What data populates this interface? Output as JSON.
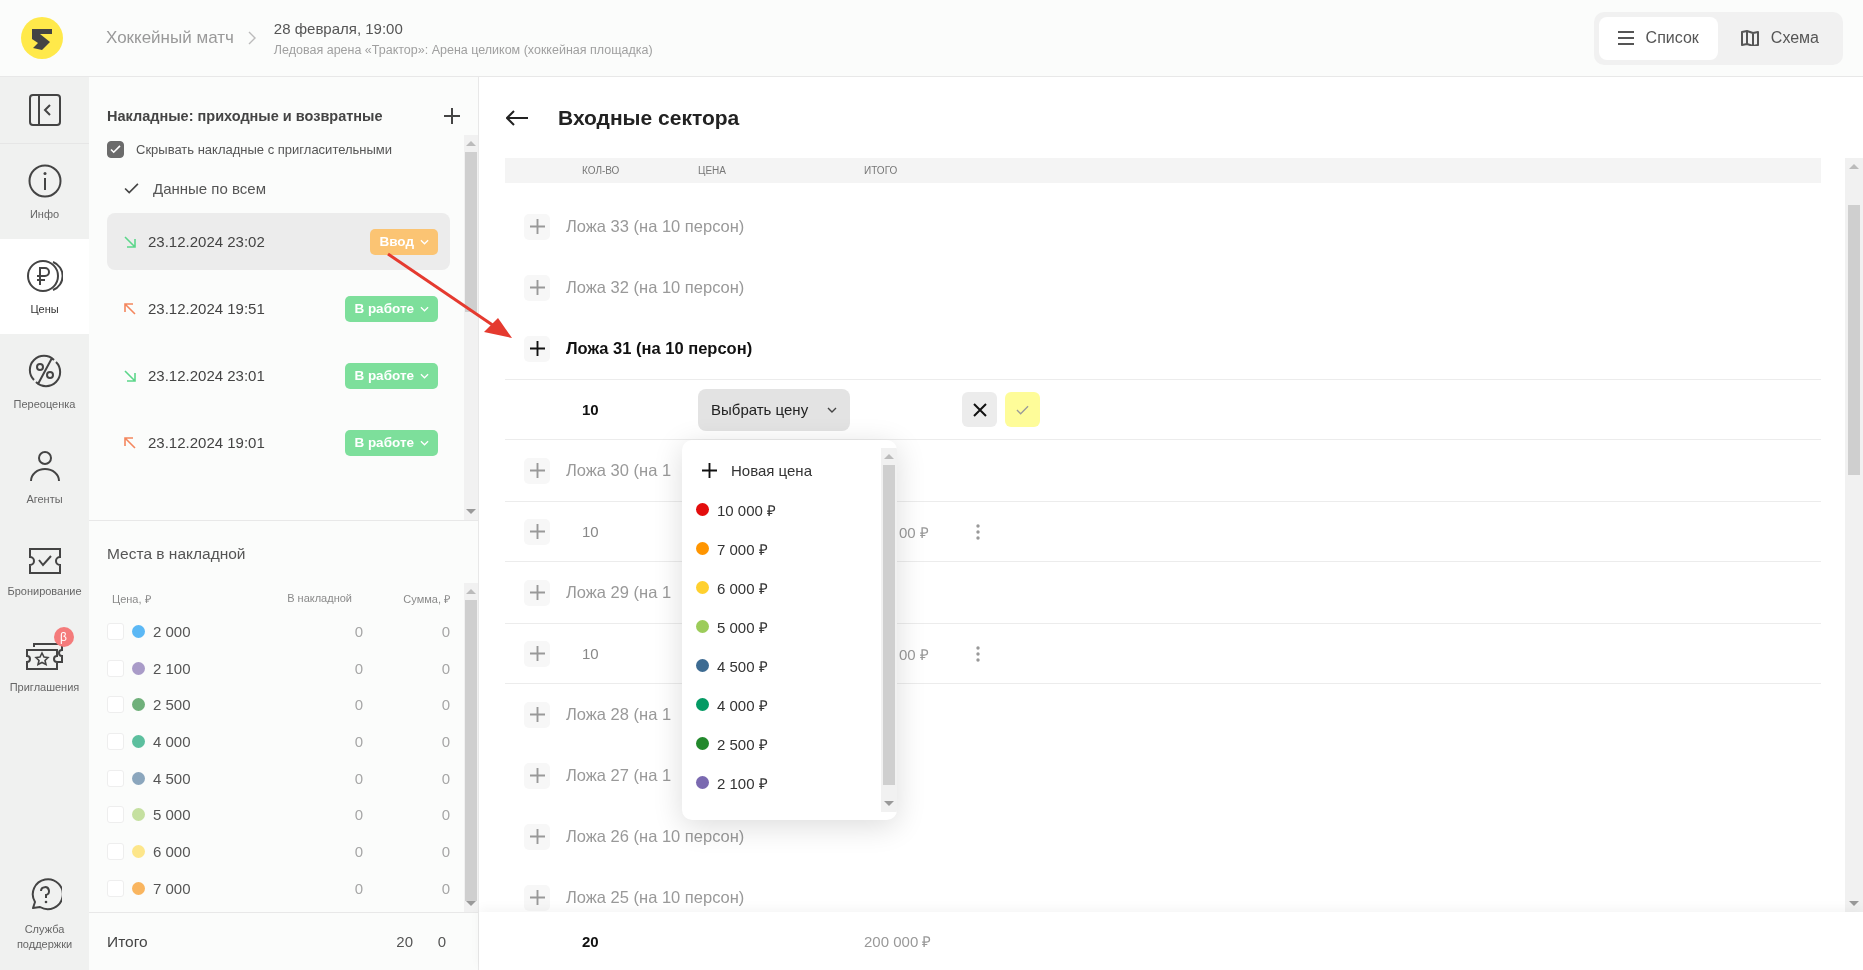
{
  "header": {
    "event": "Хоккейный матч",
    "date": "28 февраля, 19:00",
    "venue": "Ледовая арена «Трактор»: Арена целиком (хоккейная площадка)",
    "view_tabs": [
      {
        "label": "Список",
        "selected": true
      },
      {
        "label": "Схема",
        "selected": false
      }
    ]
  },
  "nav": [
    {
      "label": "Инфо",
      "selected": false
    },
    {
      "label": "Цены",
      "selected": true
    },
    {
      "label": "Переоценка",
      "selected": false
    },
    {
      "label": "Агенты",
      "selected": false
    },
    {
      "label": "Бронирование",
      "selected": false
    },
    {
      "label": "Приглашения",
      "selected": false,
      "badge": "β"
    }
  ],
  "support": {
    "label": "Служба поддержки"
  },
  "invoices": {
    "title": "Накладные: приходные и возвратные",
    "hide_invites": {
      "label": "Скрывать накладные с пригласительными",
      "checked": true
    },
    "all_data": {
      "label": "Данные по всем"
    },
    "items": [
      {
        "kind": "incoming",
        "date": "23.12.2024 23:02",
        "status": "Ввод",
        "color": "#fbc473",
        "selected": true
      },
      {
        "kind": "outgoing",
        "date": "23.12.2024 19:51",
        "status": "В работе",
        "color": "#7ddf9b",
        "selected": false
      },
      {
        "kind": "incoming",
        "date": "23.12.2024 23:01",
        "status": "В работе",
        "color": "#7ddf9b",
        "selected": false
      },
      {
        "kind": "outgoing",
        "date": "23.12.2024 19:01",
        "status": "В работе",
        "color": "#7ddf9b",
        "selected": false
      }
    ]
  },
  "places": {
    "title": "Места в накладной",
    "columns": [
      "Цена, ₽",
      "В накладной",
      "Сумма, ₽"
    ],
    "rows": [
      {
        "price": "2 000",
        "color": "#5bb8f5",
        "count": "0",
        "sum": "0",
        "checked": false
      },
      {
        "price": "2 100",
        "color": "#a99bc8",
        "count": "0",
        "sum": "0",
        "checked": false
      },
      {
        "price": "2 500",
        "color": "#6fb07a",
        "count": "0",
        "sum": "0",
        "checked": false
      },
      {
        "price": "4 000",
        "color": "#5cbf9e",
        "count": "0",
        "sum": "0",
        "checked": false
      },
      {
        "price": "4 500",
        "color": "#8ba6bd",
        "count": "0",
        "sum": "0",
        "checked": false
      },
      {
        "price": "5 000",
        "color": "#c5e0a0",
        "count": "0",
        "sum": "0",
        "checked": false
      },
      {
        "price": "6 000",
        "color": "#fde68a",
        "count": "0",
        "sum": "0",
        "checked": false
      },
      {
        "price": "7 000",
        "color": "#f9b55f",
        "count": "0",
        "sum": "0",
        "checked": false
      }
    ],
    "total": {
      "label": "Итого",
      "count": "20",
      "sum": "0"
    }
  },
  "main": {
    "title": "Входные сектора",
    "columns": [
      "КОЛ-ВО",
      "ЦЕНА",
      "ИТОГО"
    ],
    "rows": [
      {
        "kind": "group",
        "label": "Ложа 33 (на 10 персон)",
        "active": false
      },
      {
        "kind": "group",
        "label": "Ложа 32 (на 10 персон)",
        "active": false
      },
      {
        "kind": "group",
        "label": "Ложа 31 (на 10 персон)",
        "active": true
      },
      {
        "kind": "edit",
        "qty": "10",
        "select": "Выбрать цену"
      },
      {
        "kind": "group",
        "label": "Ложа 30 (на 1",
        "active": false
      },
      {
        "kind": "item",
        "qty": "10",
        "total": "00 ₽"
      },
      {
        "kind": "group",
        "label": "Ложа 29 (на 1",
        "active": false
      },
      {
        "kind": "item",
        "qty": "10",
        "total": "00 ₽"
      },
      {
        "kind": "group",
        "label": "Ложа 28 (на 1",
        "active": false
      },
      {
        "kind": "group",
        "label": "Ложа 27 (на 1",
        "active": false
      },
      {
        "kind": "group",
        "label": "Ложа 26 (на 10 персон)",
        "active": false
      },
      {
        "kind": "group",
        "label": "Ложа 25 (на 10 персон)",
        "active": false
      }
    ],
    "footer": {
      "qty": "20",
      "total": "200 000 ₽"
    },
    "dropdown": {
      "new_label": "Новая цена",
      "options": [
        {
          "label": "10 000 ₽",
          "color": "#e30d0d"
        },
        {
          "label": "7 000 ₽",
          "color": "#ff9500"
        },
        {
          "label": "6 000 ₽",
          "color": "#ffd02e"
        },
        {
          "label": "5 000 ₽",
          "color": "#9ccc5a"
        },
        {
          "label": "4 500 ₽",
          "color": "#3d6b92"
        },
        {
          "label": "4 000 ₽",
          "color": "#049a64"
        },
        {
          "label": "2 500 ₽",
          "color": "#22892c"
        },
        {
          "label": "2 100 ₽",
          "color": "#7a69b0"
        }
      ]
    }
  }
}
